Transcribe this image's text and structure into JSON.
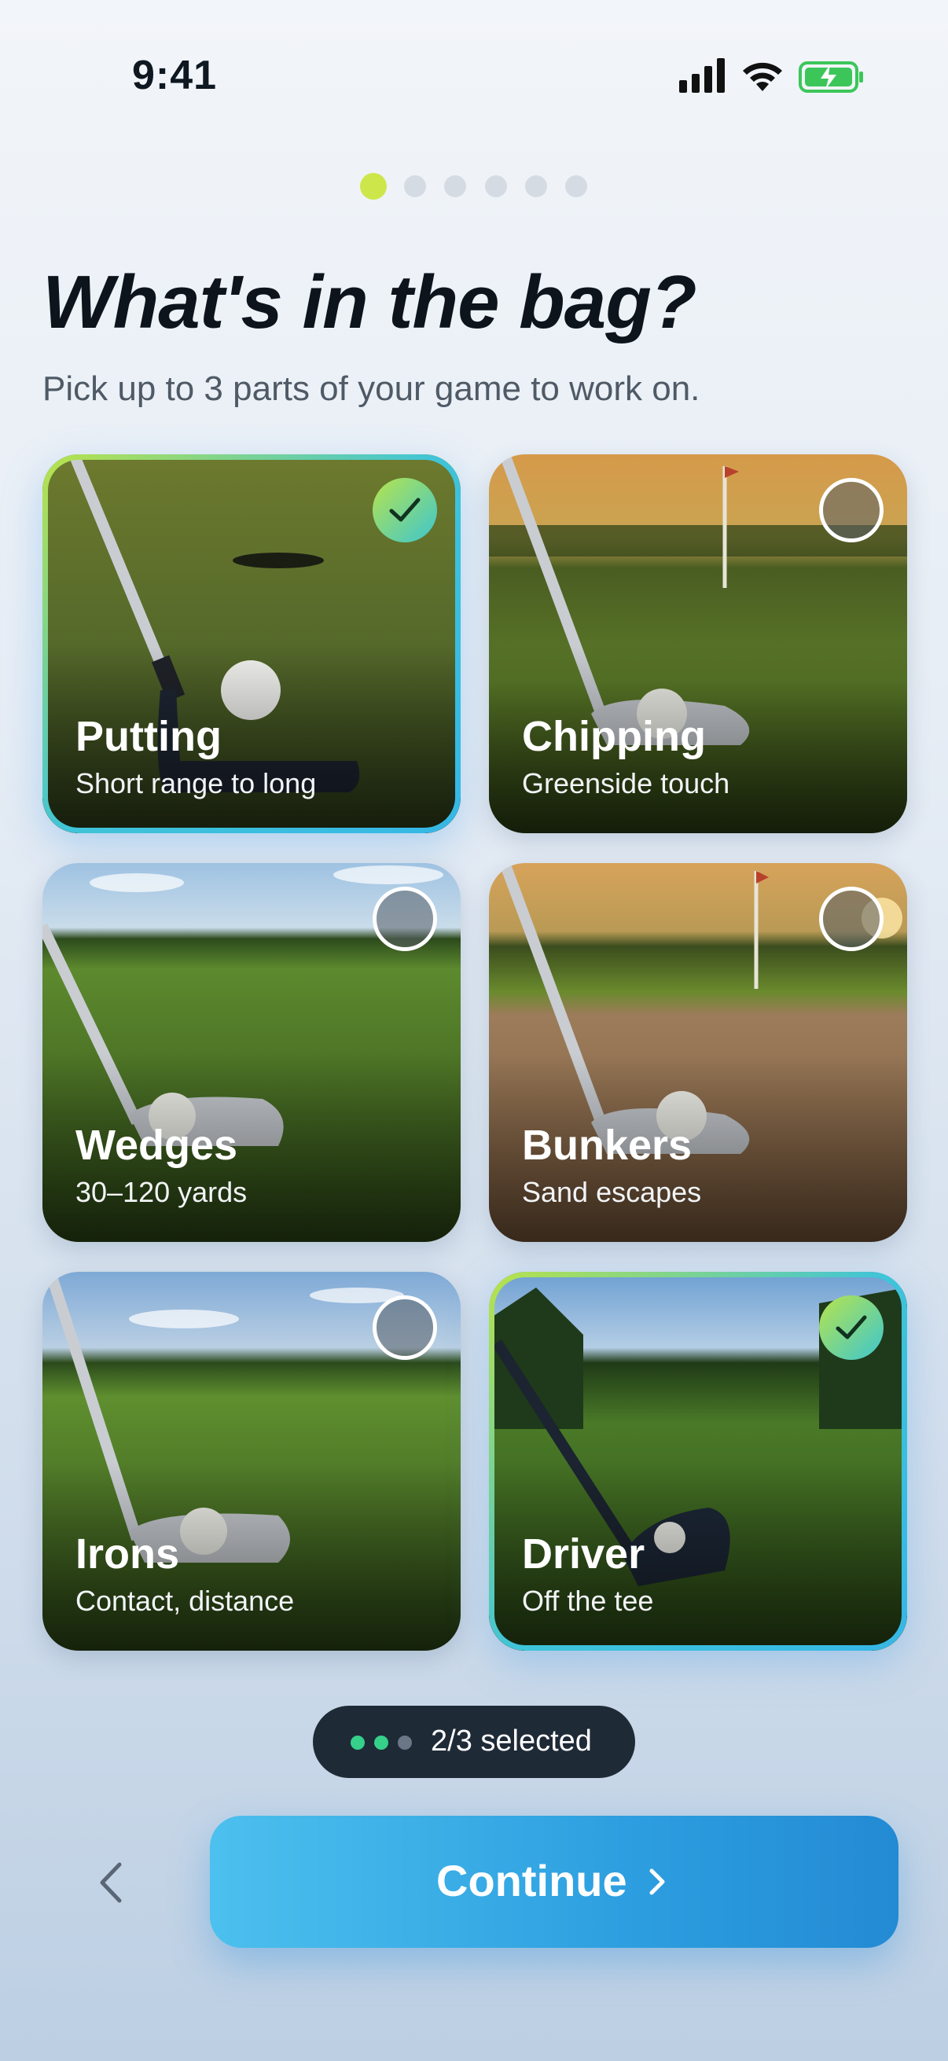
{
  "status_bar": {
    "time": "9:41"
  },
  "progress": {
    "total_steps": 6,
    "current_step": 1
  },
  "header": {
    "title": "What's in the bag?",
    "subtitle": "Pick up to 3 parts of your game to work on."
  },
  "cards": [
    {
      "title": "Putting",
      "subtitle": "Short range to long",
      "selected": true
    },
    {
      "title": "Chipping",
      "subtitle": "Greenside touch",
      "selected": false
    },
    {
      "title": "Wedges",
      "subtitle": "30–120 yards",
      "selected": false
    },
    {
      "title": "Bunkers",
      "subtitle": "Sand escapes",
      "selected": false
    },
    {
      "title": "Irons",
      "subtitle": "Contact, distance",
      "selected": false
    },
    {
      "title": "Driver",
      "subtitle": "Off the tee",
      "selected": true
    }
  ],
  "selection": {
    "label": "2/3 selected",
    "selected_count": 2,
    "max": 3
  },
  "footer": {
    "continue_label": "Continue",
    "back_icon": "chevron-left-icon",
    "continue_icon": "chevron-right-icon"
  },
  "colors": {
    "accent_lime": "#cde64a",
    "accent_teal": "#3cc6cf",
    "cta_blue": "#2d9fe0",
    "pill_bg": "#1f2a37"
  }
}
